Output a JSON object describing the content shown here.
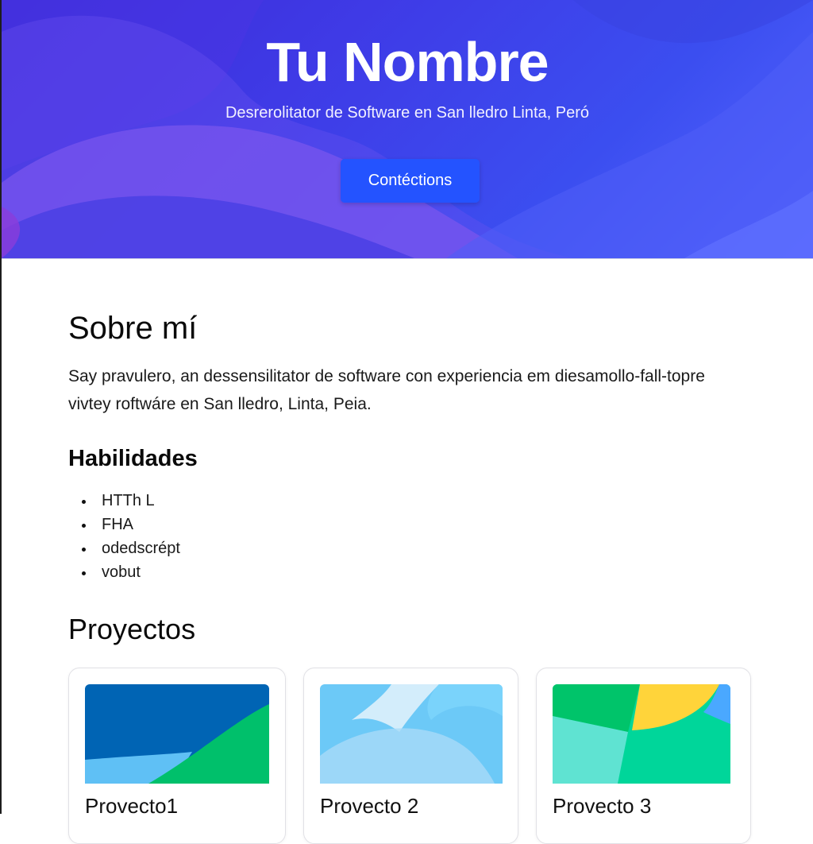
{
  "hero": {
    "title": "Tu Nombre",
    "subtitle": "Desrerolitator de Software en San lledro Linta, Peró",
    "button_label": "Contéctions"
  },
  "about": {
    "heading": "Sobre mí",
    "text": "Say pravulero, an dessensilitator de software con experiencia em diesamollo-fall-topre vivtey roftwáre en San lledro, Linta, Peia."
  },
  "skills": {
    "heading": "Habilidades",
    "items": [
      "HTTh L",
      "FHA",
      "odedscrépt",
      "vobut"
    ]
  },
  "projects": {
    "heading": "Proyectos",
    "items": [
      {
        "title": "Provecto1"
      },
      {
        "title": "Provecto 2"
      },
      {
        "title": "Provecto 3"
      }
    ]
  },
  "colors": {
    "hero_gradient": [
      "#3a2bd6",
      "#5565ff"
    ],
    "button": "#2453ff",
    "card_border": "#e1e1e6"
  }
}
